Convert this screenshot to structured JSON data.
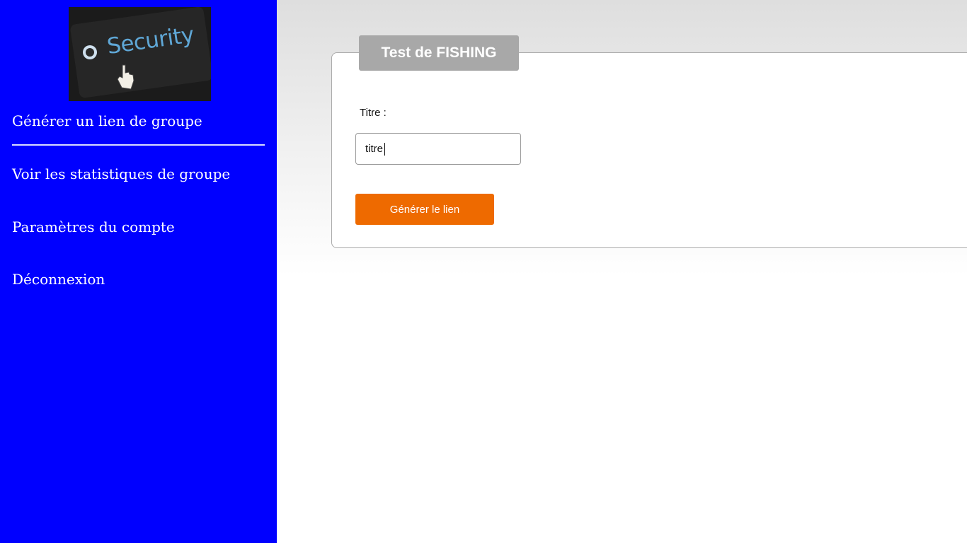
{
  "sidebar": {
    "background_color": "#0000ff",
    "logo": {
      "text": "Security",
      "icon": "hand-pointer-icon"
    },
    "items": [
      {
        "label": "Générer un lien de groupe",
        "active": true
      },
      {
        "label": "Voir les statistiques de groupe"
      },
      {
        "label": "Paramètres du compte"
      },
      {
        "label": "Déconnexion"
      }
    ]
  },
  "form": {
    "legend": "Test de FISHING",
    "title_label": "Titre :",
    "title_value": "titre",
    "submit_label": "Générer le lien",
    "accent_color": "#ee6a00"
  }
}
